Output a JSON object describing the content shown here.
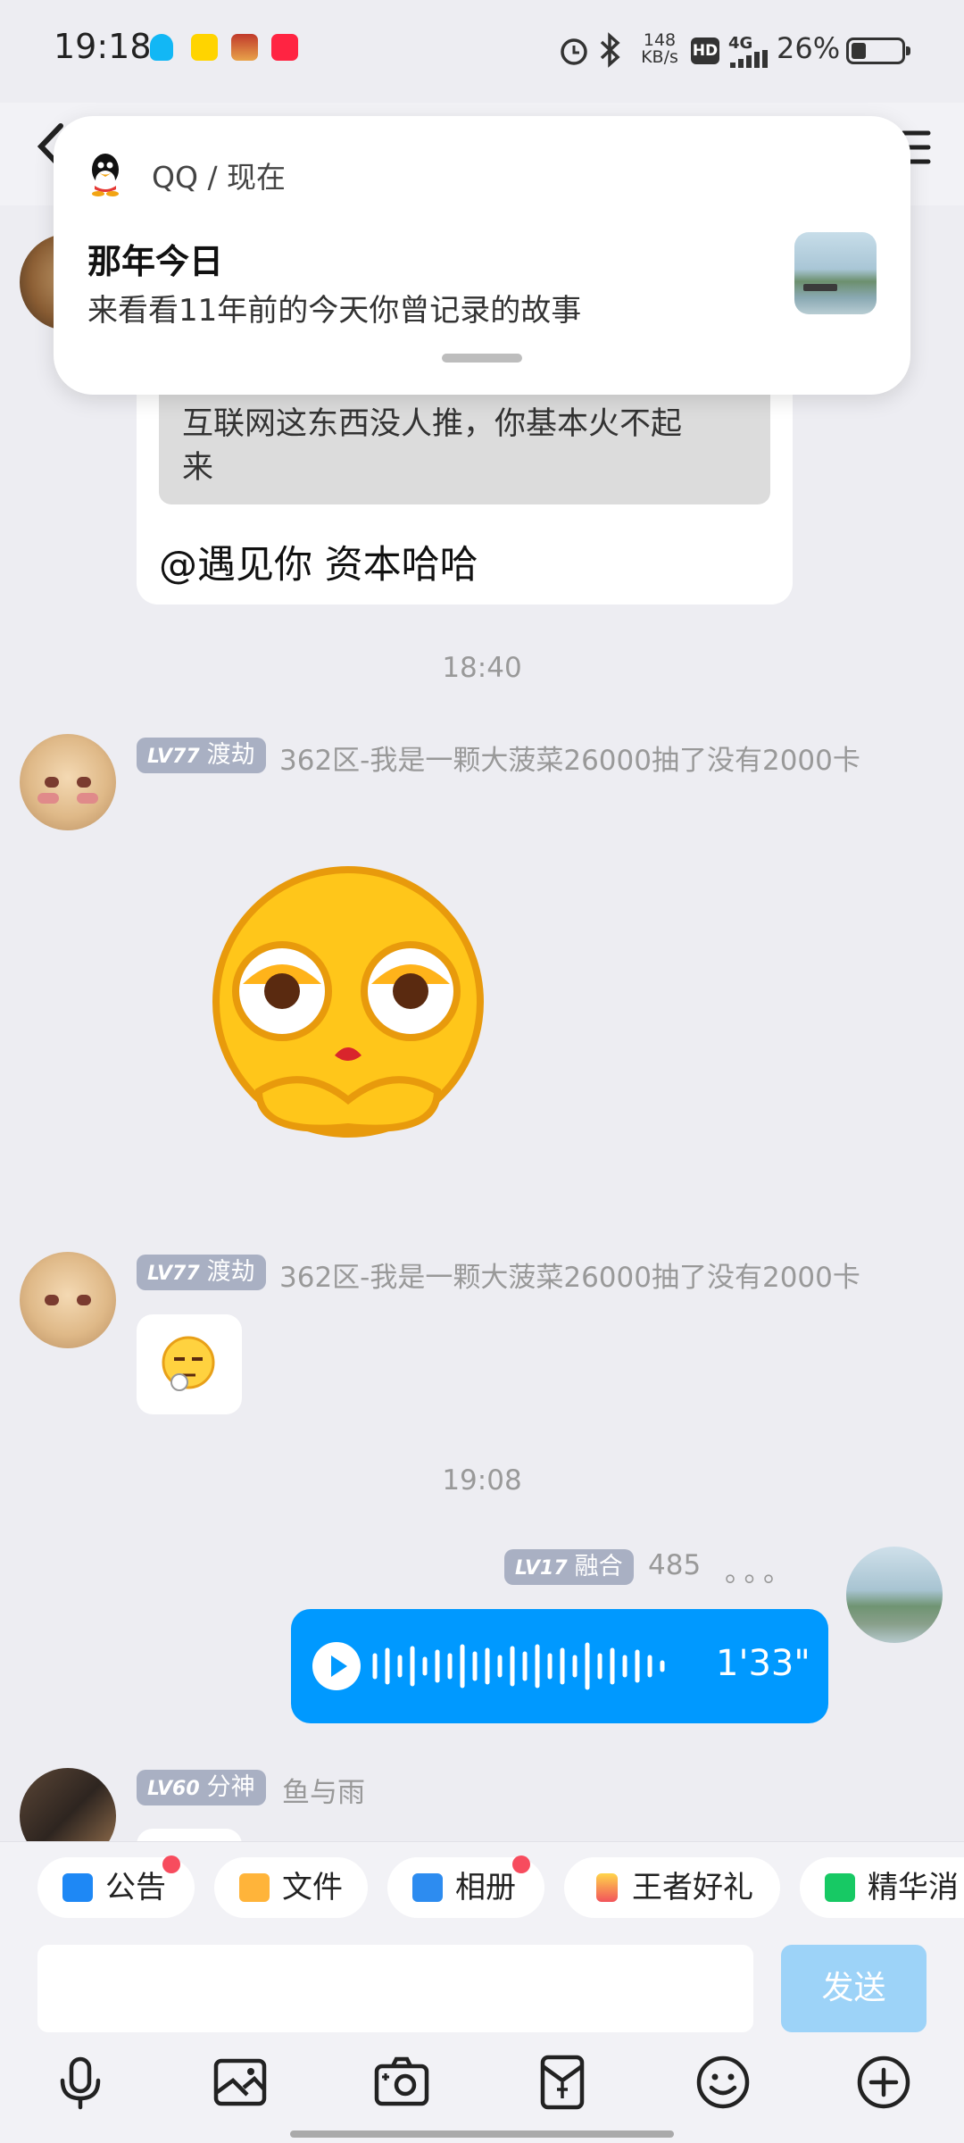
{
  "status_bar": {
    "time": "19:18",
    "net_speed_value": "148",
    "net_speed_unit": "KB/s",
    "hd": "HD",
    "signal": "4G",
    "battery_percent": "26%",
    "icons": [
      "qq-icon",
      "app-icon-yellow",
      "game-icon",
      "xiaohongshu-icon",
      "alarm-icon",
      "bluetooth-icon",
      "signal-icon",
      "battery-icon"
    ]
  },
  "notification": {
    "app_line": "QQ / 现在",
    "title": "那年今日",
    "body": "来看看11年前的今天你曾记录的故事"
  },
  "messages": {
    "quote_text_line1": "互联网这东西没人推，你基本火不起",
    "quote_text_line2": "来",
    "reply_text": "@遇见你 资本哈哈",
    "time1": "18:40",
    "msg2": {
      "level": "LV77",
      "title": "渡劫",
      "nick": "362区-我是一颗大菠菜26000抽了没有2000卡"
    },
    "msg3": {
      "level": "LV77",
      "title": "渡劫",
      "nick": "362区-我是一颗大菠菜26000抽了没有2000卡"
    },
    "time2": "19:08",
    "msg4": {
      "level": "LV17",
      "title": "融合",
      "nick": "485",
      "dots": "。。。",
      "voice_duration": "1'33\""
    },
    "msg5": {
      "level": "LV60",
      "title": "分神",
      "nick": "鱼与雨"
    }
  },
  "shortcuts": [
    "公告",
    "文件",
    "相册",
    "王者好礼",
    "精华消"
  ],
  "input": {
    "placeholder": "",
    "send_label": "发送"
  },
  "toolbar_icons": [
    "microphone-icon",
    "image-icon",
    "camera-icon",
    "red-packet-icon",
    "emoji-icon",
    "plus-icon"
  ],
  "colors": {
    "accent": "#0099FF",
    "send_disabled": "#9DD3F8",
    "badge": "#F74C5E",
    "level_badge": "#A9B0C3"
  }
}
